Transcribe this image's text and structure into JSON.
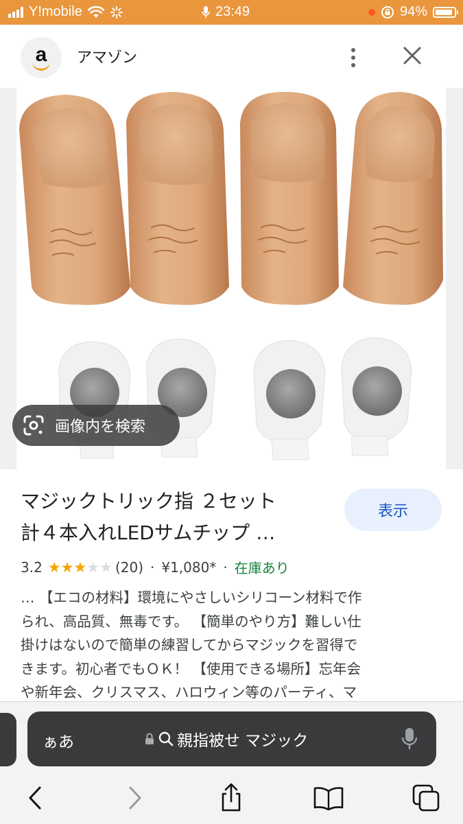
{
  "status_bar": {
    "carrier": "Y!mobile",
    "time": "23:49",
    "battery": "94%",
    "battery_level": 0.94,
    "background": "#e9963c"
  },
  "header": {
    "site_name": "アマゾン",
    "logo_letter": "a",
    "icons": [
      "amazon-logo",
      "more-vert-icon",
      "close-icon"
    ]
  },
  "image": {
    "lens_label": "画像内を検索",
    "icons": [
      "lens-icon"
    ]
  },
  "result": {
    "title_line1": "マジックトリック指 ２セット",
    "title_line2": "計４本入れLEDサムチップ …",
    "view_button": "表示",
    "rating": "3.2",
    "stars_filled": 3,
    "stars_total": 5,
    "review_count": "(20)",
    "separator": "·",
    "price": "¥1,080*",
    "availability": "在庫あり",
    "description": [
      "… 【エコの材料】環境にやさしいシリコーン材料で作",
      "られ、高品質、無毒です。 【簡単のやり方】難しい仕",
      "掛けはないので簡単の練習してからマジックを習得で",
      "きます。初心者でもＯＫ！ 【使用できる場所】忘年会",
      "や新年会、クリスマス、ハロウィン等のパーティ、マ"
    ],
    "accent_color": "#1a56c6",
    "stock_color": "#188038",
    "star_color": "#f2a600"
  },
  "toolbar": {
    "address_left": "ぁあ",
    "address_text": "親指被せ マジック",
    "icons": [
      "lock-icon",
      "search-icon",
      "mic-icon",
      "back-icon",
      "forward-icon",
      "share-icon",
      "bookmarks-icon",
      "tabs-icon"
    ]
  }
}
